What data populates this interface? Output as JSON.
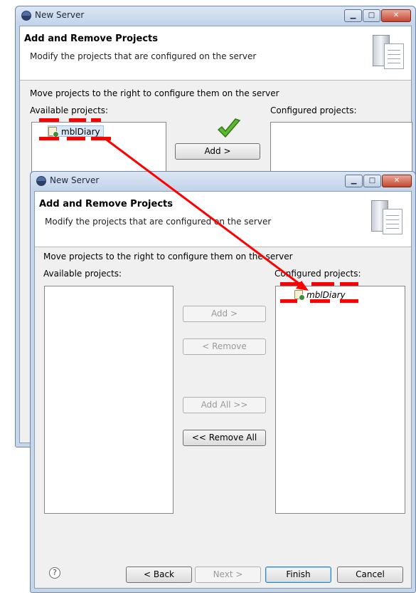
{
  "back_window": {
    "title": "New Server",
    "banner_title": "Add and Remove Projects",
    "banner_desc": "Modify the projects that are configured on the server",
    "instruction": "Move projects to the right to configure them on the server",
    "available_label": "Available projects:",
    "configured_label": "Configured projects:",
    "available_items": [
      "mblDiary"
    ],
    "add_label": "Add >"
  },
  "front_window": {
    "title": "New Server",
    "banner_title": "Add and Remove Projects",
    "banner_desc": "Modify the projects that are configured on the server",
    "instruction": "Move projects to the right to configure them on the server",
    "available_label": "Available projects:",
    "configured_label": "Configured projects:",
    "configured_items": [
      "mblDiary"
    ],
    "buttons": {
      "add": "Add >",
      "remove": "< Remove",
      "add_all": "Add All >>",
      "remove_all": "<< Remove All"
    },
    "footer": {
      "help": "?",
      "back": "< Back",
      "next": "Next >",
      "finish": "Finish",
      "cancel": "Cancel"
    }
  },
  "annotation_color": "#ff0000"
}
